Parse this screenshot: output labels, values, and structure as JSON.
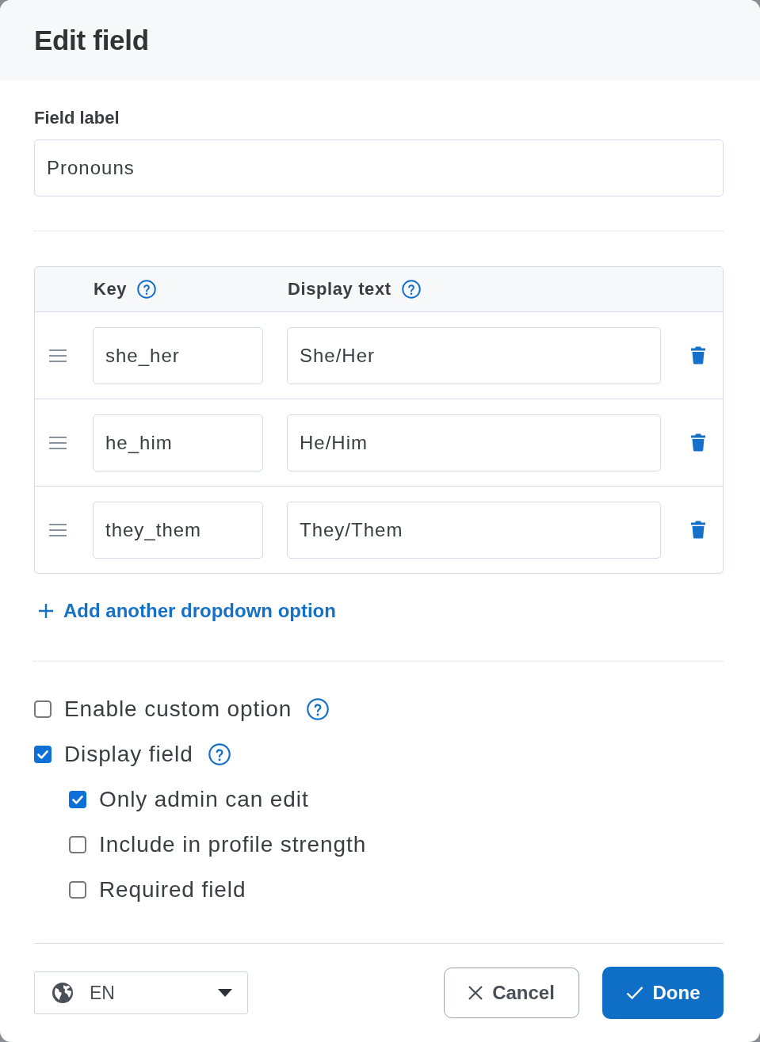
{
  "dialog": {
    "title": "Edit field"
  },
  "field_label": {
    "label": "Field label",
    "value": "Pronouns"
  },
  "options_table": {
    "columns": [
      {
        "label": "Key",
        "help": true
      },
      {
        "label": "Display text",
        "help": true
      }
    ],
    "rows": [
      {
        "key": "she_her",
        "display_text": "She/Her"
      },
      {
        "key": "he_him",
        "display_text": "He/Him"
      },
      {
        "key": "they_them",
        "display_text": "They/Them"
      }
    ]
  },
  "add_option_link": {
    "label": "Add another dropdown option"
  },
  "settings": [
    {
      "label": "Enable custom option",
      "checked": false,
      "help": true
    },
    {
      "label": "Display field",
      "checked": true,
      "help": true,
      "children": [
        {
          "label": "Only admin can edit",
          "checked": true,
          "help": false
        },
        {
          "label": "Include in profile strength",
          "checked": false,
          "help": false
        },
        {
          "label": "Required field",
          "checked": false,
          "help": false
        }
      ]
    }
  ],
  "footer": {
    "language_select": {
      "value": "EN"
    },
    "buttons": [
      {
        "label": "Cancel",
        "kind": "secondary"
      },
      {
        "label": "Done",
        "kind": "primary"
      }
    ]
  }
}
